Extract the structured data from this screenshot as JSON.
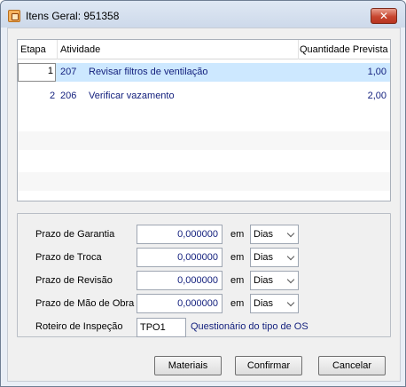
{
  "window": {
    "title": "Itens Geral: 951358",
    "close_label": "✕"
  },
  "grid": {
    "columns": [
      "Etapa",
      "Atividade",
      "Quantidade Prevista"
    ],
    "rows": [
      {
        "etapa": "1",
        "codigo": "207",
        "descricao": "Revisar filtros de ventilação",
        "quantidade": "1,00"
      },
      {
        "etapa": "2",
        "codigo": "206",
        "descricao": "Verificar vazamento",
        "quantidade": "2,00"
      }
    ]
  },
  "form": {
    "prazo_garantia": {
      "label": "Prazo de Garantia",
      "value": "0,000000",
      "em": "em",
      "unit": "Dias"
    },
    "prazo_troca": {
      "label": "Prazo de Troca",
      "value": "0,000000",
      "em": "em",
      "unit": "Dias"
    },
    "prazo_revisao": {
      "label": "Prazo de Revisão",
      "value": "0,000000",
      "em": "em",
      "unit": "Dias"
    },
    "prazo_mao_obra": {
      "label": "Prazo de Mão de Obra",
      "value": "0,000000",
      "em": "em",
      "unit": "Dias"
    },
    "roteiro": {
      "label": "Roteiro de Inspeção",
      "value": "TPO1",
      "description": "Questionário do tipo de OS"
    }
  },
  "buttons": {
    "materiais": "Materiais",
    "confirmar": "Confirmar",
    "cancelar": "Cancelar"
  }
}
